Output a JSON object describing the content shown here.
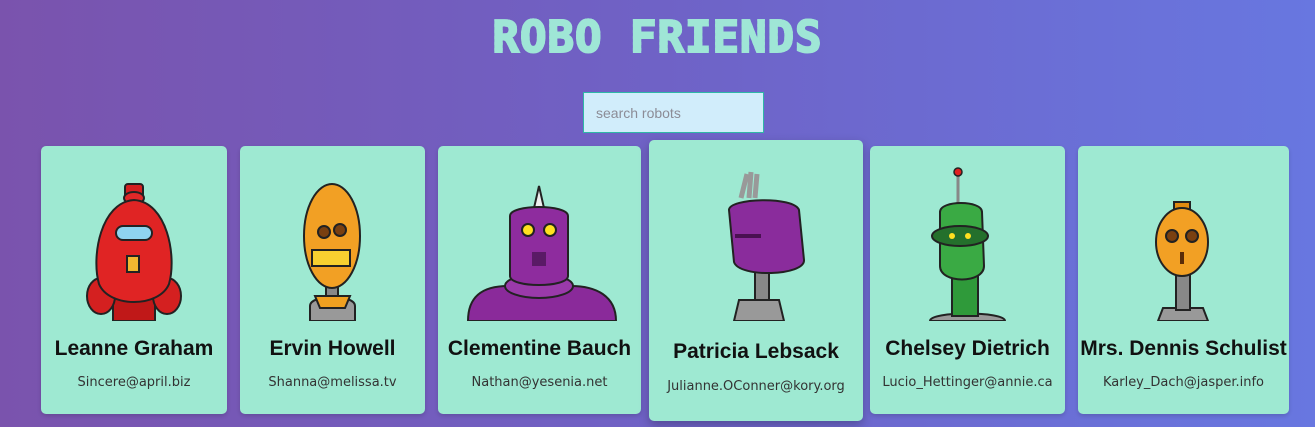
{
  "app": {
    "title": "ROBO FRIENDS"
  },
  "search": {
    "placeholder": "search robots",
    "value": ""
  },
  "colors": {
    "background_start": "#7a53ad",
    "background_end": "#6877e0",
    "title": "#9fe6d6",
    "card": "#9ee9d2",
    "search_bg": "#d1edfb"
  },
  "robots": [
    {
      "name": "Leanne Graham",
      "email": "Sincere@april.biz",
      "avatar": "red-robot-icon"
    },
    {
      "name": "Ervin Howell",
      "email": "Shanna@melissa.tv",
      "avatar": "orange-robot-icon"
    },
    {
      "name": "Clementine Bauch",
      "email": "Nathan@yesenia.net",
      "avatar": "purple-robot-icon"
    },
    {
      "name": "Patricia Lebsack",
      "email": "Julianne.OConner@kory.org",
      "avatar": "purple-robot-icon"
    },
    {
      "name": "Chelsey Dietrich",
      "email": "Lucio_Hettinger@annie.ca",
      "avatar": "green-robot-icon"
    },
    {
      "name": "Mrs. Dennis Schulist",
      "email": "Karley_Dach@jasper.info",
      "avatar": "orange-robot-icon"
    }
  ]
}
